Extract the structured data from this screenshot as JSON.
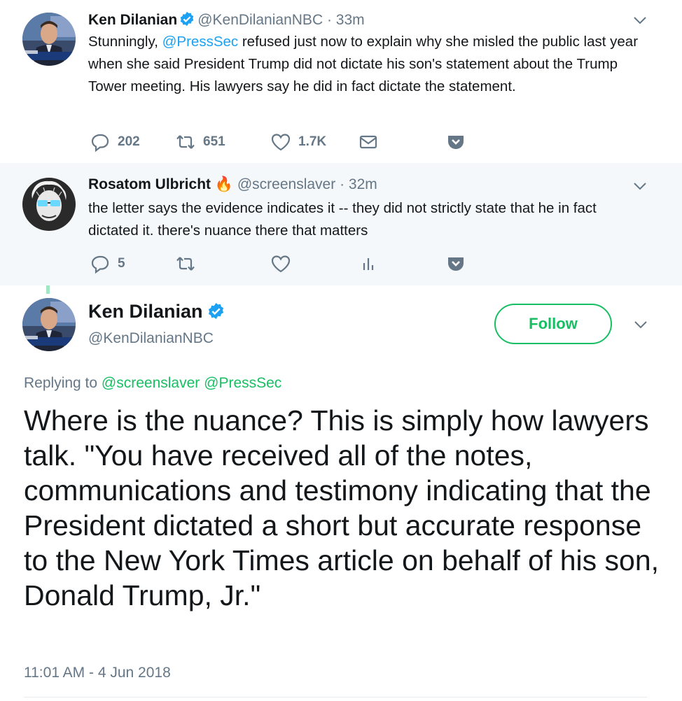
{
  "tweet1": {
    "name": "Ken Dilanian",
    "handle": "@KenDilanianNBC",
    "time": "· 33m",
    "text_parts": [
      "Stunningly, ",
      "@PressSec",
      " refused just now to explain why she misled the public last year when she said President Trump did not dictate his son's statement about the Trump Tower meeting.  His lawyers say he did in fact dictate the statement."
    ],
    "replies": "202",
    "retweets": "651",
    "likes": "1.7K"
  },
  "tweet2": {
    "name": "Rosatom Ulbricht",
    "name_emoji": "🔥",
    "handle": "@screenslaver",
    "time": "· 32m",
    "text": "the letter says the evidence indicates it -- they did not strictly state that he in fact dictated it. there's nuance there that matters",
    "replies": "5"
  },
  "main": {
    "name": "Ken Dilanian",
    "handle": "@KenDilanianNBC",
    "follow_label": "Follow",
    "replying_label": "Replying to",
    "replying_to_1": "@screenslaver",
    "replying_to_2": "@PressSec",
    "text": "Where is the nuance? This is simply how lawyers talk.  \"You have received all of the notes, communications and testimony indicating that the President dictated a short but accurate response to the New York Times article on behalf of his son, Donald Trump, Jr.\"",
    "timestamp": "11:01 AM - 4 Jun 2018"
  },
  "colors": {
    "link": "#1da1f2",
    "follow_green": "#17bf63",
    "thread_line": "#a3e6c3",
    "muted": "#657786",
    "reply_bg": "#f5f8fa",
    "verified": "#1da1f2"
  },
  "icons": [
    "reply-icon",
    "retweet-icon",
    "like-icon",
    "dm-icon",
    "analytics-icon",
    "pocket-icon",
    "verified-badge-icon",
    "chevron-down-icon",
    "fire-emoji"
  ]
}
